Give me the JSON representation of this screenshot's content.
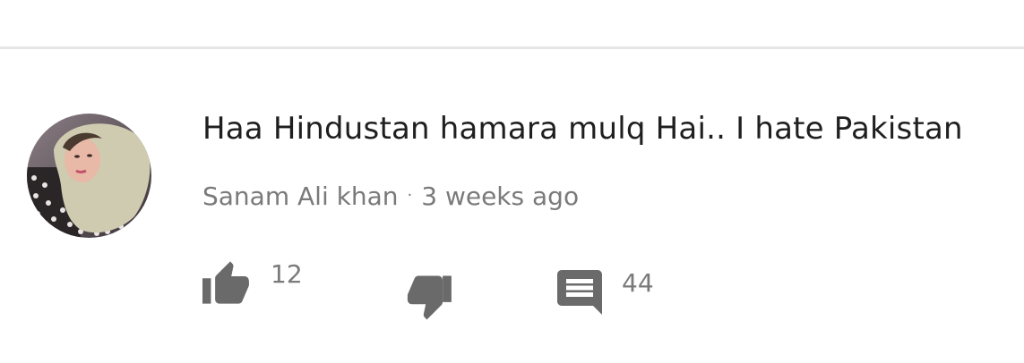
{
  "comment": {
    "text": "Haa Hindustan hamara mulq Hai.. I hate Pakistan",
    "author": "Sanam Ali khan",
    "separator": "·",
    "time": "3 weeks ago",
    "avatar_icon": "user-avatar-photo"
  },
  "actions": {
    "like": {
      "icon": "thumbs-up-icon",
      "count": "12"
    },
    "dislike": {
      "icon": "thumbs-down-icon"
    },
    "reply": {
      "icon": "comment-icon",
      "count": "44"
    }
  },
  "colors": {
    "text": "#1f1f1f",
    "meta": "#7a7a7a",
    "icon": "#6a6a6a",
    "divider": "#e6e6e6"
  }
}
